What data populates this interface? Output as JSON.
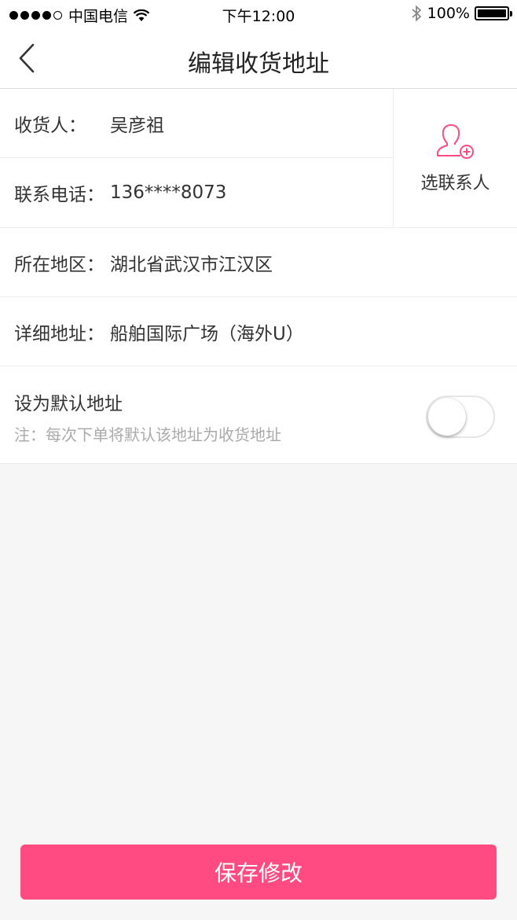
{
  "status_bar": {
    "carrier": "中国电信",
    "time": "下午12:00",
    "battery": "100%",
    "signal_bars": 4
  },
  "nav": {
    "title": "编辑收货地址",
    "back_icon": "chevron-left-icon"
  },
  "form": {
    "recipient_label": "收货人：",
    "recipient_value": "吴彦祖",
    "phone_label": "联系电话：",
    "phone_value": "136****8073",
    "pick_contact_label": "选联系人",
    "pick_contact_icon": "add-contact-icon",
    "region_label": "所在地区：",
    "region_value": "湖北省武汉市江汉区",
    "address_label": "详细地址：",
    "address_value": "船舶国际广场（海外U）",
    "default_title": "设为默认地址",
    "default_note": "注：每次下单将默认该地址为收货地址",
    "default_on": false
  },
  "save_button": "保存修改",
  "colors": {
    "accent": "#ff4b81",
    "background": "#f6f6f6"
  }
}
